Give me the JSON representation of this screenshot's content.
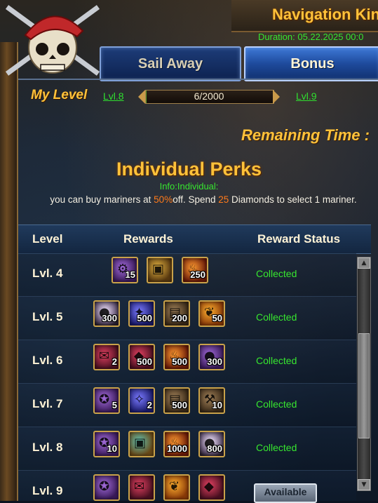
{
  "header": {
    "title": "Navigation Kin",
    "duration": "Duration: 05.22.2025 00:0"
  },
  "tabs": [
    {
      "label": "Sail Away",
      "active": false
    },
    {
      "label": "Bonus",
      "active": true
    }
  ],
  "level": {
    "label": "My Level",
    "current": "Lvl.8",
    "next": "Lvl.9",
    "progress_text": "6/2000",
    "progress_fraction": 0.003
  },
  "remaining_label": "Remaining Time :",
  "perks": {
    "title": "Individual Perks",
    "info": "Info:Individual:",
    "desc_1": "you can buy mariners at ",
    "desc_pct": "50%",
    "desc_2": "off. Spend ",
    "desc_num": "25",
    "desc_3": " Diamonds to select 1 mariner."
  },
  "table": {
    "headers": [
      "Level",
      "Rewards",
      "Reward Status"
    ],
    "rows": [
      {
        "level": "Lvl. 4",
        "status": "Collected",
        "items": [
          {
            "qty": "15",
            "color": "c-purple",
            "icon": "gear-icon"
          },
          {
            "qty": "",
            "color": "c-gold",
            "icon": "chest-icon"
          },
          {
            "qty": "250",
            "color": "c-fire",
            "icon": "flame-icon"
          }
        ]
      },
      {
        "level": "Lvl. 5",
        "status": "Collected",
        "items": [
          {
            "qty": "300",
            "color": "c-pearl",
            "icon": "pearl-icon"
          },
          {
            "qty": "500",
            "color": "c-blue",
            "icon": "crystal-icon"
          },
          {
            "qty": "200",
            "color": "c-brown",
            "icon": "book-icon"
          },
          {
            "qty": "50",
            "color": "c-orange",
            "icon": "feather-icon"
          }
        ]
      },
      {
        "level": "Lvl. 6",
        "status": "Collected",
        "items": [
          {
            "qty": "2",
            "color": "c-red",
            "icon": "scroll-icon"
          },
          {
            "qty": "500",
            "color": "c-red",
            "icon": "gem-icon"
          },
          {
            "qty": "500",
            "color": "c-fire",
            "icon": "flame-icon"
          },
          {
            "qty": "300",
            "color": "c-purple",
            "icon": "pearl-icon"
          }
        ]
      },
      {
        "level": "Lvl. 7",
        "status": "Collected",
        "items": [
          {
            "qty": "5",
            "color": "c-purple",
            "icon": "orb-icon"
          },
          {
            "qty": "2",
            "color": "c-blue",
            "icon": "rune-icon"
          },
          {
            "qty": "500",
            "color": "c-brown",
            "icon": "book-icon"
          },
          {
            "qty": "10",
            "color": "c-brown",
            "icon": "hammer-icon"
          }
        ]
      },
      {
        "level": "Lvl. 8",
        "status": "Collected",
        "items": [
          {
            "qty": "10",
            "color": "c-purple",
            "icon": "orb-icon"
          },
          {
            "qty": "",
            "color": "c-teal",
            "icon": "chest-icon"
          },
          {
            "qty": "1000",
            "color": "c-fire",
            "icon": "flame-icon"
          },
          {
            "qty": "800",
            "color": "c-pearl",
            "icon": "pearl-icon"
          }
        ]
      },
      {
        "level": "Lvl. 9",
        "status": "Available",
        "items": [
          {
            "qty": "",
            "color": "c-purple",
            "icon": "orb-icon"
          },
          {
            "qty": "",
            "color": "c-red",
            "icon": "scroll-icon"
          },
          {
            "qty": "",
            "color": "c-orange",
            "icon": "feather-icon"
          },
          {
            "qty": "",
            "color": "c-red",
            "icon": "gem-icon"
          }
        ]
      }
    ]
  },
  "colors": {
    "gold_text": "#ffc23a",
    "green_text": "#37e62f",
    "highlight": "#ff7a1a"
  }
}
